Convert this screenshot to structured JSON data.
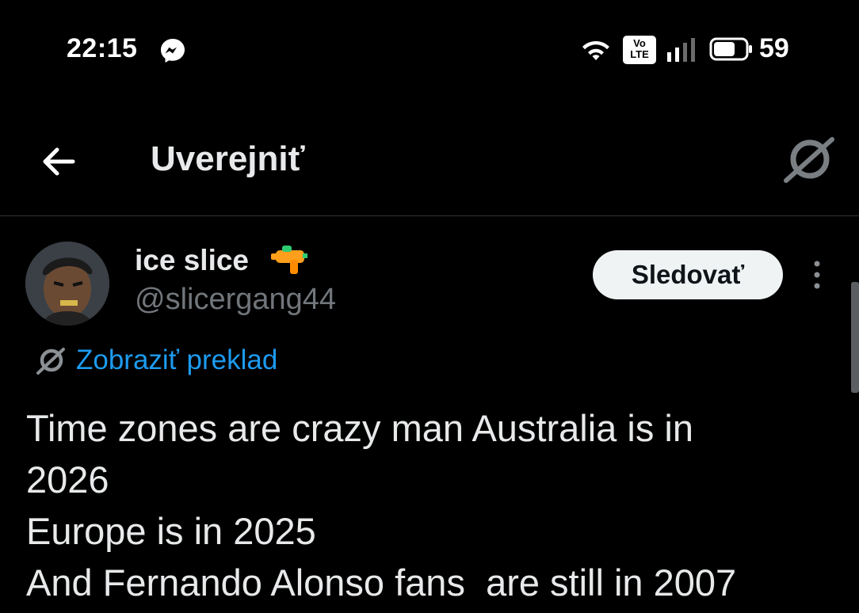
{
  "status_bar": {
    "time": "22:15",
    "network_badge": "Vo\nLTE",
    "battery_percent": "59",
    "icons": [
      "messenger-icon",
      "wifi-icon",
      "volte-icon",
      "signal-icon",
      "battery-icon"
    ]
  },
  "header": {
    "title": "Uverejniť",
    "back_icon": "arrow-left-icon",
    "grok_icon": "grok-icon"
  },
  "post": {
    "display_name": "ice slice",
    "name_emoji": "water-gun-emoji",
    "handle": "@slicergang44",
    "follow_label": "Sledovať",
    "more_icon": "vertical-dots-icon",
    "translate_label": "Zobraziť preklad",
    "text_lines": [
      "Time zones are crazy man Australia is in",
      "2026",
      "Europe is in 2025",
      "And Fernando Alonso fans  are still in 2007"
    ]
  },
  "colors": {
    "background": "#000000",
    "text_primary": "#e7e9ea",
    "text_secondary": "#71767b",
    "link": "#1d9bf0",
    "follow_bg": "#eff3f4",
    "divider": "#2f3336"
  }
}
